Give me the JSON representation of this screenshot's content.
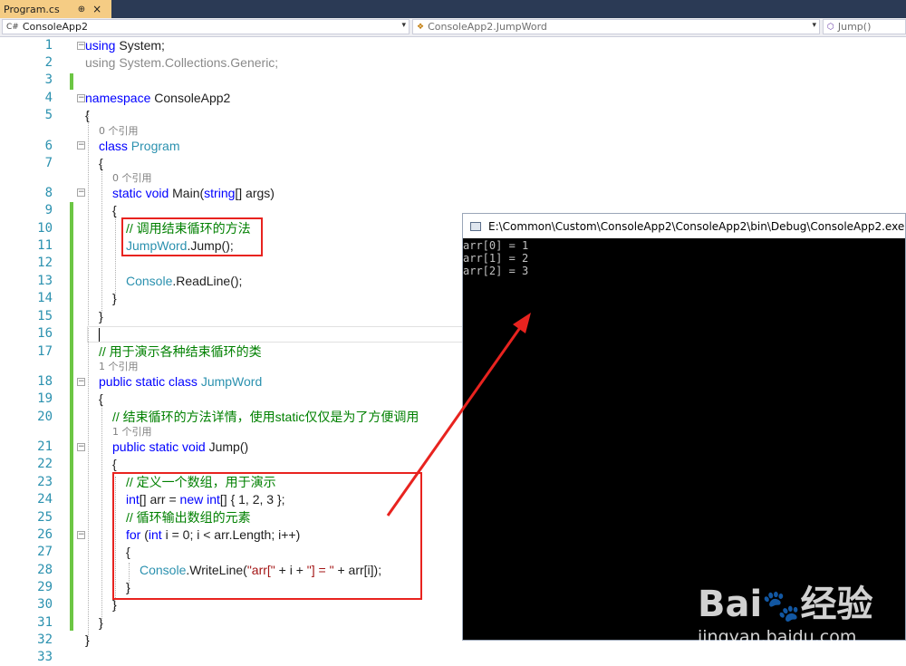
{
  "tab": {
    "filename": "Program.cs",
    "pin_icon": "pin-icon",
    "close_icon": "close-icon"
  },
  "navbar": {
    "project": "ConsoleApp2",
    "class": "ConsoleApp2.JumpWord",
    "member": "Jump()"
  },
  "code": {
    "line_numbers": [
      "1",
      "2",
      "3",
      "4",
      "5",
      "6",
      "7",
      "8",
      "9",
      "10",
      "11",
      "12",
      "13",
      "14",
      "15",
      "16",
      "17",
      "18",
      "19",
      "20",
      "21",
      "22",
      "23",
      "24",
      "25",
      "26",
      "27",
      "28",
      "29",
      "30",
      "31",
      "32",
      "33"
    ],
    "refs": {
      "zero_refs": "0 个引用",
      "one_ref": "1 个引用"
    },
    "using_kw": "using",
    "using_system": " System;",
    "using_generic": "using System.Collections.Generic;",
    "namespace_kw": "namespace",
    "namespace_name": " ConsoleApp2",
    "brace_open": "{",
    "brace_close": "}",
    "class_kw": "class",
    "class_name": " Program",
    "static_void": "static void",
    "main_sig_a": " Main(",
    "string_kw": "string",
    "main_sig_b": "[] args)",
    "comment_call": "// 调用结束循环的方法",
    "jumpword_type": "JumpWord",
    "jump_call": ".Jump();",
    "console_type": "Console",
    "readline": ".ReadLine();",
    "comment_class": "// 用于演示各种结束循环的类",
    "public_static_class": "public static class",
    "jumpword_name": " JumpWord",
    "comment_method": "// 结束循环的方法详情，使用static仅仅是为了方便调用",
    "public_static_void": "public static void",
    "jump_sig": " Jump()",
    "comment_array": "// 定义一个数组，用于演示",
    "int_kw": "int",
    "arr_decl_a": "[] arr = ",
    "new_kw": "new",
    "arr_decl_b": "[] { 1, 2, 3 };",
    "comment_loop": "// 循环输出数组的元素",
    "for_kw": "for",
    "for_a": " (",
    "for_b": " i = 0; i < arr.Length; i++)",
    "writeline": ".WriteLine(",
    "str_arr_open": "\"arr[\"",
    "plus_i_plus": " + i + ",
    "str_close_eq": "\"] = \"",
    "plus_arr_i": " + arr[i]);"
  },
  "console": {
    "title": "E:\\Common\\Custom\\ConsoleApp2\\ConsoleApp2\\bin\\Debug\\ConsoleApp2.exe",
    "output": [
      "arr[0] = 1",
      "arr[1] = 2",
      "arr[2] = 3"
    ]
  },
  "watermark": {
    "brand": "Bai",
    "brand_cn": "经验",
    "url": "jingyan.baidu.com"
  },
  "colors": {
    "tab_active": "#f5cc84",
    "keyword": "#0000ff",
    "type": "#2b91af",
    "comment": "#008000",
    "string": "#a31515",
    "annotation": "#e8231f"
  }
}
